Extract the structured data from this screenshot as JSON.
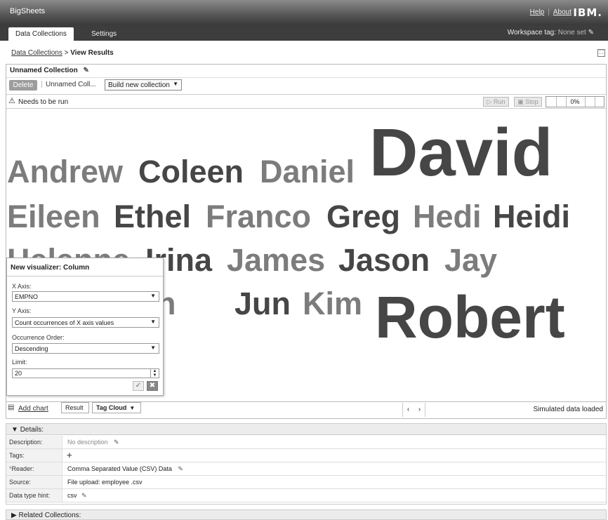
{
  "header": {
    "brand": "BigSheets",
    "help_link": "Help",
    "about_link": "About",
    "logo_text": "IBM."
  },
  "tabs": [
    {
      "label": "Data Collections"
    },
    {
      "label": "Settings"
    }
  ],
  "workspace": {
    "label": "Workspace tag:",
    "value": "None set"
  },
  "breadcrumb": {
    "link": "Data Collections",
    "separator": ">",
    "current": "View Results"
  },
  "collection": {
    "title": "Unnamed Collection",
    "delete_label": "Delete",
    "sheet_tab": "Unnamed Coll...",
    "build_select": "Build new collection",
    "status": "Needs to be run",
    "run_label": "Run",
    "stop_label": "Stop",
    "progress_text": "0%",
    "progress_value": 0
  },
  "tag_cloud": {
    "tags": [
      {
        "text": "Andrew",
        "tone": "light"
      },
      {
        "text": "Coleen",
        "tone": "dark"
      },
      {
        "text": "Daniel",
        "tone": "light"
      },
      {
        "text": "David",
        "tone": "dark"
      },
      {
        "text": "Eileen",
        "tone": "light"
      },
      {
        "text": "Ethel",
        "tone": "dark"
      },
      {
        "text": "Franco",
        "tone": "light"
      },
      {
        "text": "Greg",
        "tone": "dark"
      },
      {
        "text": "Hedi",
        "tone": "light"
      },
      {
        "text": "Heidi",
        "tone": "dark"
      },
      {
        "text": "Helenne",
        "tone": "light"
      },
      {
        "text": "Irina",
        "tone": "dark"
      },
      {
        "text": "James",
        "tone": "light"
      },
      {
        "text": "Jason",
        "tone": "dark"
      },
      {
        "text": "Jay",
        "tone": "light"
      },
      {
        "text": "John",
        "tone": "light"
      },
      {
        "text": "Jun",
        "tone": "dark"
      },
      {
        "text": "Kim",
        "tone": "light"
      },
      {
        "text": "Robert",
        "tone": "dark"
      }
    ]
  },
  "visualizer": {
    "title": "New visualizer: Column",
    "x_axis_label": "X Axis:",
    "x_axis_value": "EMPNO",
    "y_axis_label": "Y Axis:",
    "y_axis_value": "Count occurrences of X axis values",
    "order_label": "Occurrence Order:",
    "order_value": "Descending",
    "limit_label": "Limit:",
    "limit_value": "20"
  },
  "chart_tabs": {
    "add_chart": "Add chart",
    "result_tab": "Result",
    "cloud_tab": "Tag Cloud",
    "prev": "‹",
    "next": "›",
    "status": "Simulated data loaded"
  },
  "details": {
    "title": "Details:",
    "rows": [
      {
        "label": "Description:",
        "value": "No description"
      },
      {
        "label": "Tags:",
        "value": ""
      },
      {
        "label": "Reader:",
        "value": "Comma Separated Value (CSV) Data"
      },
      {
        "label": "Source:",
        "value": "File upload: employee .csv"
      },
      {
        "label": "Data type hint:",
        "value": "csv"
      }
    ]
  },
  "related": {
    "title": "Related Collections:"
  }
}
